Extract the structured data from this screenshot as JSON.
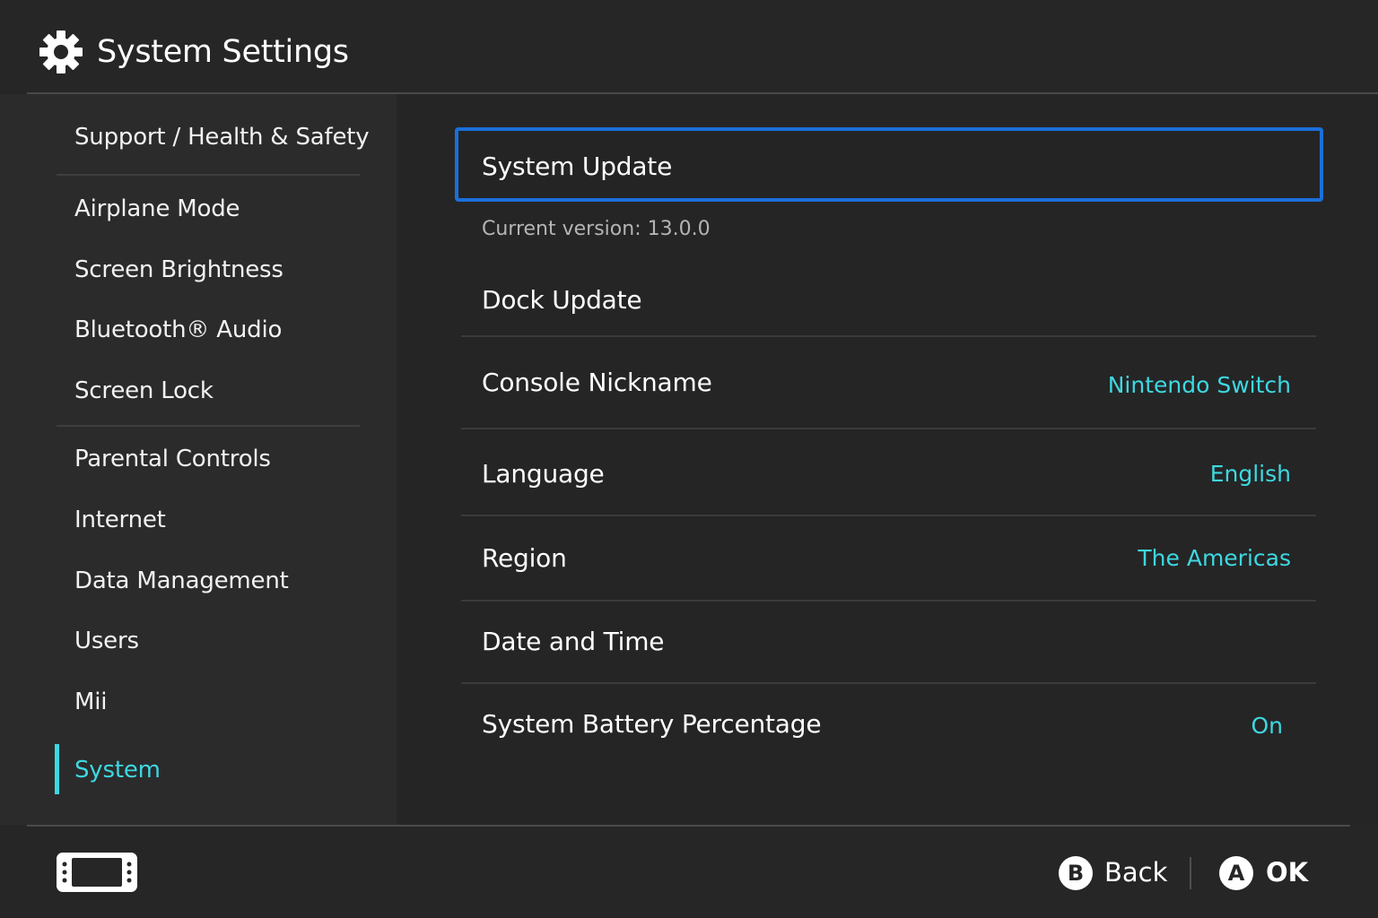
{
  "header": {
    "title": "System Settings",
    "icon": "gear-icon"
  },
  "sidebar": {
    "items": [
      {
        "label": "Support / Health & Safety",
        "active": false
      },
      {
        "label": "Airplane Mode",
        "active": false
      },
      {
        "label": "Screen Brightness",
        "active": false
      },
      {
        "label": "Bluetooth® Audio",
        "active": false
      },
      {
        "label": "Screen Lock",
        "active": false
      },
      {
        "label": "Parental Controls",
        "active": false
      },
      {
        "label": "Internet",
        "active": false
      },
      {
        "label": "Data Management",
        "active": false
      },
      {
        "label": "Users",
        "active": false
      },
      {
        "label": "Mii",
        "active": false
      },
      {
        "label": "System",
        "active": true
      }
    ]
  },
  "main": {
    "rows": [
      {
        "label": "System Update",
        "value": "",
        "subtext": "Current version: 13.0.0",
        "focused": true
      },
      {
        "label": "Dock Update",
        "value": ""
      },
      {
        "label": "Console Nickname",
        "value": "Nintendo Switch"
      },
      {
        "label": "Language",
        "value": "English"
      },
      {
        "label": "Region",
        "value": "The Americas"
      },
      {
        "label": "Date and Time",
        "value": ""
      },
      {
        "label": "System Battery Percentage",
        "value": "On"
      }
    ]
  },
  "footer": {
    "console_icon": "handheld-console-icon",
    "back": {
      "button": "B",
      "label": "Back"
    },
    "ok": {
      "button": "A",
      "label": "OK"
    }
  },
  "colors": {
    "accent": "#3ed8e0",
    "focus": "#1b6fd9",
    "background": "#252526",
    "sidebar": "#2b2b2c"
  }
}
